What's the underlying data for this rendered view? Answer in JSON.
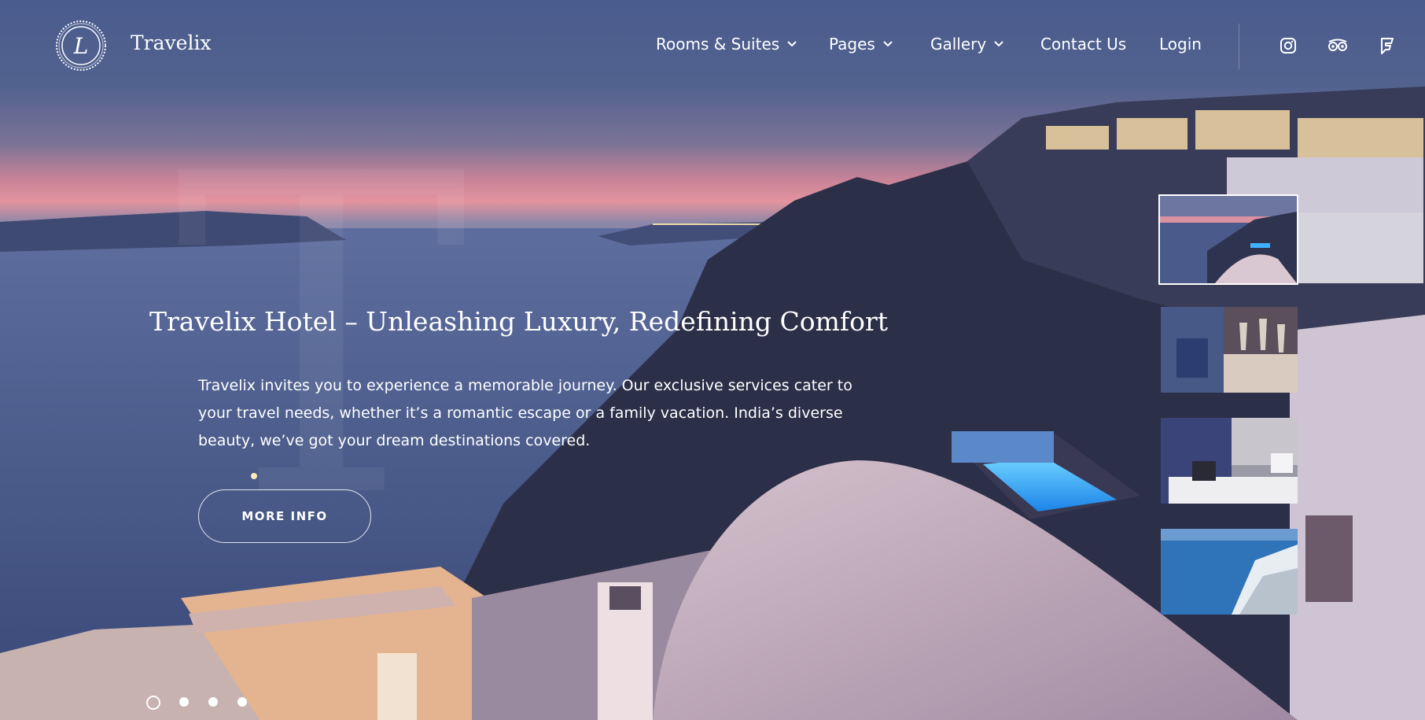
{
  "brand": {
    "name": "Travelix",
    "logo_letter": "L"
  },
  "nav": {
    "items": [
      {
        "label": "Rooms & Suites",
        "has_dropdown": true
      },
      {
        "label": "Pages",
        "has_dropdown": true
      },
      {
        "label": "Gallery",
        "has_dropdown": true
      },
      {
        "label": "Contact Us",
        "has_dropdown": false
      },
      {
        "label": "Login",
        "has_dropdown": false
      }
    ],
    "social": [
      "instagram-icon",
      "tripadvisor-icon",
      "foursquare-icon"
    ]
  },
  "hero": {
    "watermark_letter": "T",
    "headline": "Travelix Hotel – Unleashing Luxury, Redefining Comfort",
    "description": " Travelix invites you to experience a memorable journey. Our exclusive services cater to your travel needs, whether it’s a romantic escape or a family vacation. India’s diverse beauty, we’ve got your dream destinations covered.",
    "cta_label": "MORE INFO"
  },
  "slider": {
    "active_index": 0,
    "slide_count": 4,
    "thumbnails": [
      "sunset-terrace-thumbnail",
      "dining-glasses-thumbnail",
      "hotel-bedroom-thumbnail",
      "coastal-village-thumbnail"
    ]
  },
  "colors": {
    "sky_top": "#4b5e8f",
    "sunset": "#d98a9a",
    "sea": "#465987",
    "text": "#ffffff"
  }
}
